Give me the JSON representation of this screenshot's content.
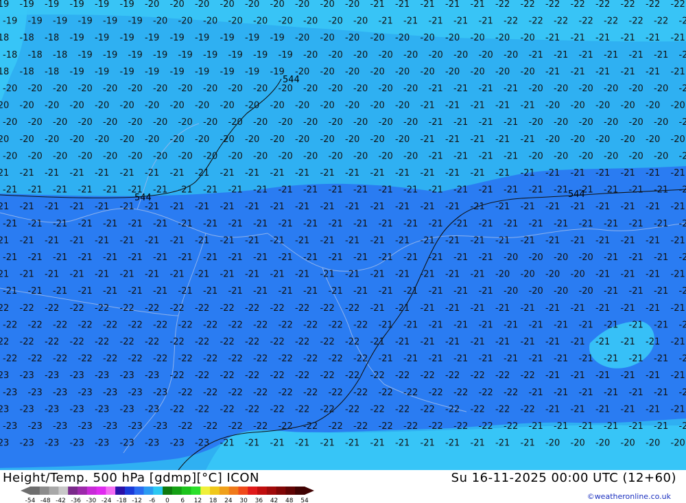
{
  "title": "Height/Temp. 500 hPa [gdmp][°C] ICON",
  "valid_time": "Su 16-11-2025 00:00 UTC (12+60)",
  "credit": "©weatheronline.co.uk",
  "geopotential_label": "544",
  "colors": {
    "cold_zone": "#2a7cf2",
    "mild_zone": "#2fb0f2",
    "warm_zone": "#39c8f7",
    "contour": "#101010",
    "border": "#9ab8ea"
  },
  "legend": {
    "ticks": [
      "-54",
      "-48",
      "-42",
      "-36",
      "-30",
      "-24",
      "-18",
      "-12",
      "-6",
      "0",
      "6",
      "12",
      "18",
      "24",
      "30",
      "36",
      "42",
      "48",
      "54"
    ],
    "colors": [
      "#6e6e6e",
      "#8c8c8c",
      "#a8a8a8",
      "#c8c8c8",
      "#7a2a8a",
      "#9c2aaa",
      "#c82ad8",
      "#e02af0",
      "#f26cf2",
      "#2a10a8",
      "#1a3ad8",
      "#2a6cf0",
      "#2a9cf2",
      "#2ac8f2",
      "#0e7a0e",
      "#14a014",
      "#1cc41c",
      "#2ae02a",
      "#f0f03a",
      "#f0c81a",
      "#f0a01a",
      "#f07a1a",
      "#f04a1a",
      "#e01a1a",
      "#c00e0e",
      "#a00a0a",
      "#800606",
      "#600404",
      "#400202"
    ]
  }
}
